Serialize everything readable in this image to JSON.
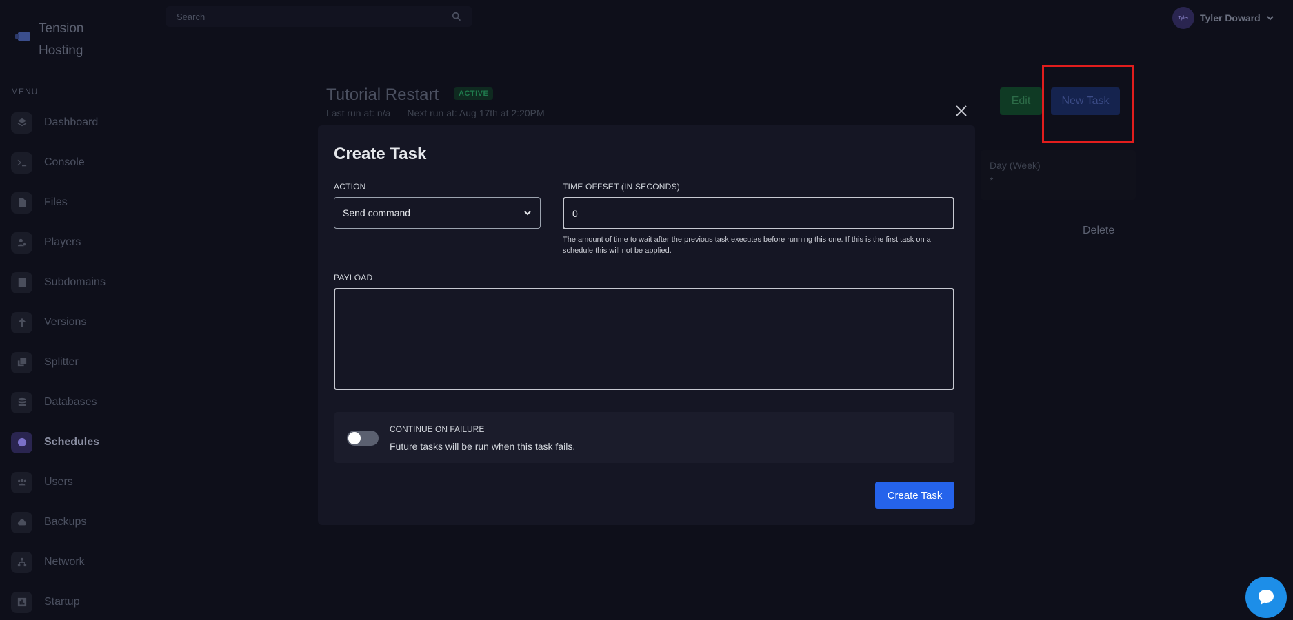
{
  "brand": {
    "name": "Tension Hosting"
  },
  "sidebar": {
    "menu_label": "MENU",
    "items": [
      {
        "label": "Dashboard",
        "icon": "layers-icon",
        "active": false
      },
      {
        "label": "Console",
        "icon": "terminal-icon",
        "active": false
      },
      {
        "label": "Files",
        "icon": "file-icon",
        "active": false
      },
      {
        "label": "Players",
        "icon": "players-icon",
        "active": false
      },
      {
        "label": "Subdomains",
        "icon": "contact-icon",
        "active": false
      },
      {
        "label": "Versions",
        "icon": "arrow-up-icon",
        "active": false
      },
      {
        "label": "Splitter",
        "icon": "copy-icon",
        "active": false
      },
      {
        "label": "Databases",
        "icon": "database-icon",
        "active": false
      },
      {
        "label": "Schedules",
        "icon": "clock-icon",
        "active": true
      },
      {
        "label": "Users",
        "icon": "users-icon",
        "active": false
      },
      {
        "label": "Backups",
        "icon": "cloud-icon",
        "active": false
      },
      {
        "label": "Network",
        "icon": "network-icon",
        "active": false
      },
      {
        "label": "Startup",
        "icon": "chart-icon",
        "active": false
      }
    ]
  },
  "topbar": {
    "search_placeholder": "Search",
    "user_name": "Tyler Doward",
    "avatar_text": "Tyler"
  },
  "schedule": {
    "title": "Tutorial Restart",
    "status": "ACTIVE",
    "last_run": "Last run at: n/a",
    "next_run": "Next run at: Aug 17th at 2:20PM",
    "edit_label": "Edit",
    "new_task_label": "New Task",
    "day_week_label": "Day (Week)",
    "day_week_value": "*",
    "delete_label": "Delete"
  },
  "modal": {
    "title": "Create Task",
    "action_label": "ACTION",
    "action_value": "Send command",
    "offset_label": "TIME OFFSET (IN SECONDS)",
    "offset_value": "0",
    "offset_help": "The amount of time to wait after the previous task executes before running this one. If this is the first task on a schedule this will not be applied.",
    "payload_label": "PAYLOAD",
    "payload_value": "",
    "continue_title": "CONTINUE ON FAILURE",
    "continue_desc": "Future tasks will be run when this task fails.",
    "continue_enabled": false,
    "submit_label": "Create Task"
  },
  "colors": {
    "background": "#0e0f1a",
    "modal": "#151624",
    "primary": "#2563eb",
    "highlight": "#e11d1d",
    "chat": "#1d8ee8"
  }
}
